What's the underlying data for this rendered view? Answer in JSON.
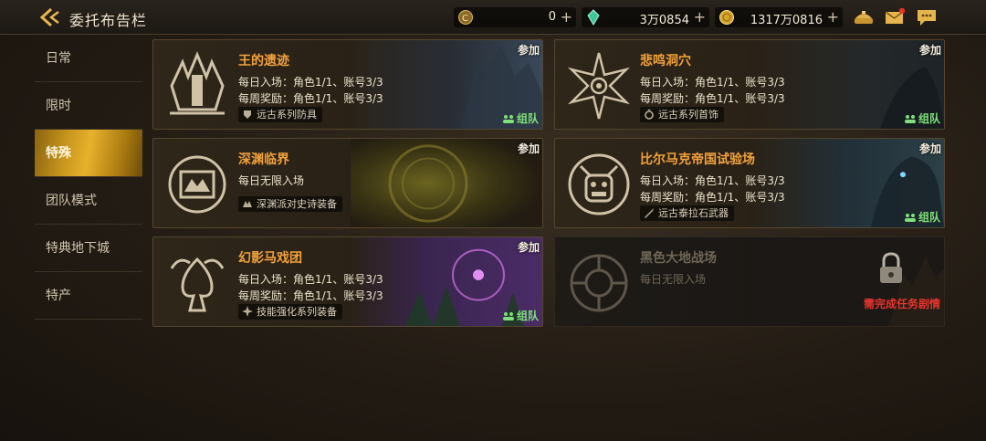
{
  "header": {
    "title": "委托布告栏",
    "resources": [
      {
        "icon": "gold-coin-c-icon",
        "value": "0"
      },
      {
        "icon": "crystal-icon",
        "value": "3万0854"
      },
      {
        "icon": "gold-coin-icon",
        "value": "1317万0816"
      }
    ],
    "icons": [
      "shop-icon",
      "mail-icon",
      "chat-icon"
    ]
  },
  "sidebar": {
    "items": [
      {
        "label": "日常"
      },
      {
        "label": "限时"
      },
      {
        "label": "特殊",
        "active": true
      },
      {
        "label": "团队模式"
      },
      {
        "label": "特典地下城"
      },
      {
        "label": "特产"
      }
    ]
  },
  "cards": [
    {
      "name": "王的遗迹",
      "line1": "每日入场：角色1/1、账号3/3",
      "line2": "每周奖励：角色1/1、账号3/3",
      "tag": "远古系列防具",
      "join": "参加",
      "team": "组队"
    },
    {
      "name": "悲鸣洞穴",
      "line1": "每日入场：角色1/1、账号3/3",
      "line2": "每周奖励：角色1/1、账号3/3",
      "tag": "远古系列首饰",
      "join": "参加",
      "team": "组队"
    },
    {
      "name": "深渊临界",
      "line1": "每日无限入场",
      "tag": "深渊派对史诗装备",
      "join": "参加"
    },
    {
      "name": "比尔马克帝国试验场",
      "line1": "每日入场：角色1/1、账号3/3",
      "line2": "每周奖励：角色1/1、账号3/3",
      "tag": "远古泰拉石武器",
      "join": "参加",
      "team": "组队"
    },
    {
      "name": "幻影马戏团",
      "line1": "每日入场：角色1/1、账号3/3",
      "line2": "每周奖励：角色1/1、账号3/3",
      "tag": "技能强化系列装备",
      "join": "参加",
      "team": "组队"
    },
    {
      "name": "黑色大地战场",
      "line1": "每日无限入场",
      "locked_text": "需完成任务剧情",
      "locked": true
    }
  ],
  "colors": {
    "accent": "#e7b12c",
    "title_orange": "#f3a23a",
    "team_green": "#7ee07a",
    "locked_red": "#e8352c"
  }
}
